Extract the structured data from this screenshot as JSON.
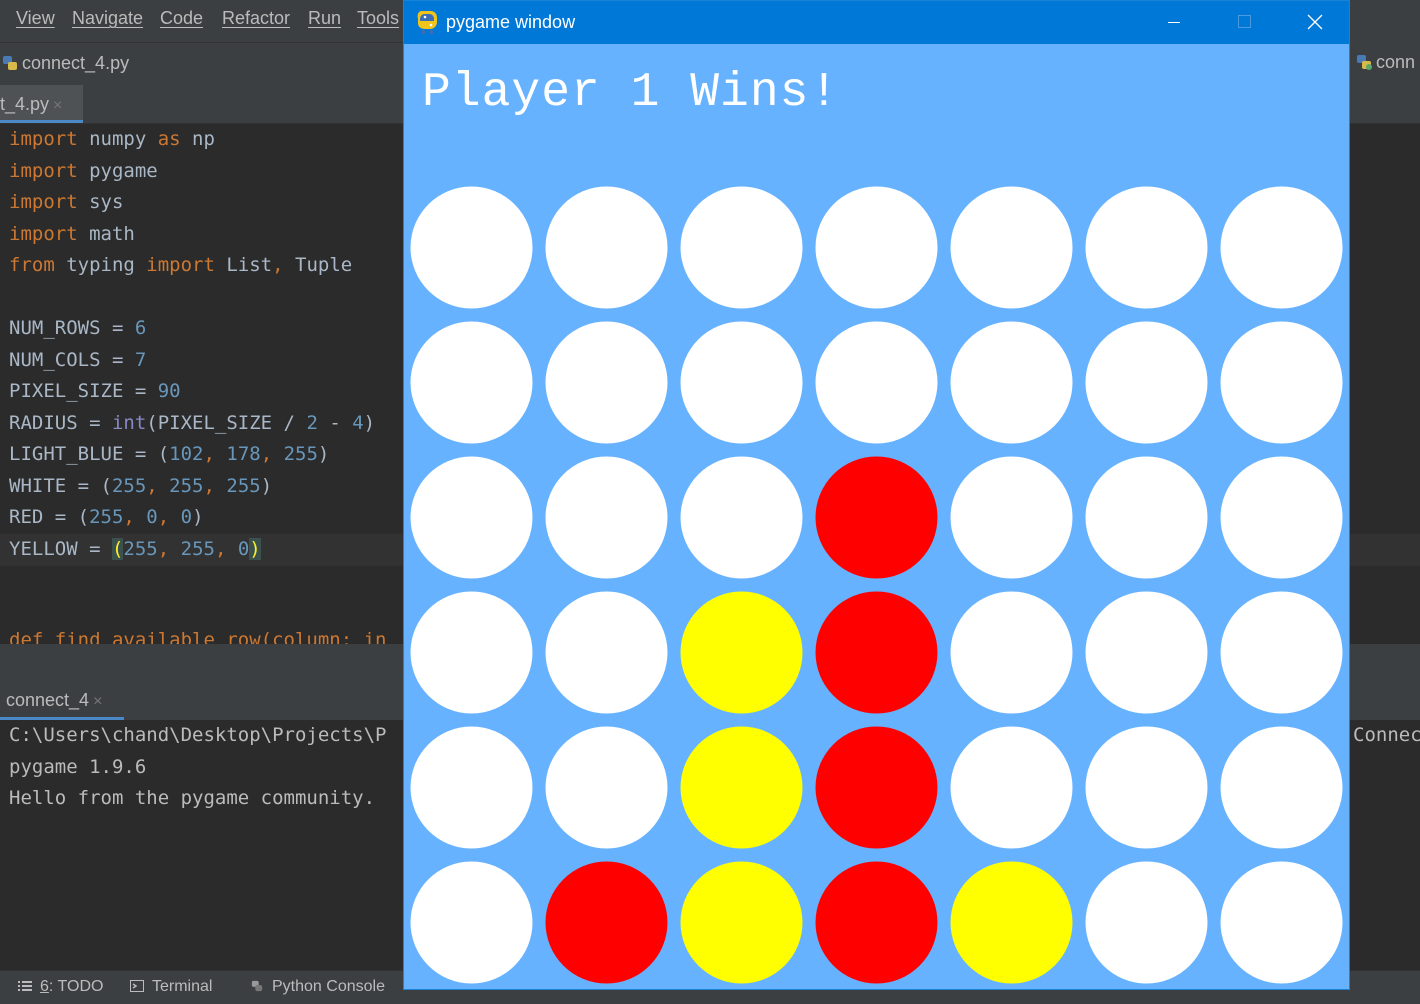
{
  "menubar": {
    "items": [
      "View",
      "Navigate",
      "Code",
      "Refactor",
      "Run",
      "Tools"
    ]
  },
  "navbar": {
    "file_label": "connect_4.py",
    "right_file_label": "conn"
  },
  "editor": {
    "tab_label": "t_4.py",
    "tab_close": "×"
  },
  "code": {
    "line1": {
      "kw": "import",
      "rest1": " numpy ",
      "kw2": "as",
      "rest2": " np"
    },
    "line2": {
      "kw": "import",
      "rest": " pygame"
    },
    "line3": {
      "kw": "import",
      "rest": " sys"
    },
    "line4": {
      "kw": "import",
      "rest": " math"
    },
    "line5": {
      "kw1": "from",
      "mid": " typing ",
      "kw2": "import",
      "rest": " List",
      "comma": ",",
      "rest2": " Tuple"
    },
    "num_rows": {
      "name": "NUM_ROWS = ",
      "value": "6"
    },
    "num_cols": {
      "name": "NUM_COLS = ",
      "value": "7"
    },
    "pixel_size": {
      "name": "PIXEL_SIZE = ",
      "value": "90"
    },
    "radius": {
      "name": "RADIUS = ",
      "fn": "int",
      "arg": "(PIXEL_SIZE / ",
      "n1": "2",
      "op": " - ",
      "n2": "4",
      "close": ")"
    },
    "light_blue": {
      "name": "LIGHT_BLUE = (",
      "v1": "102",
      "c1": ", ",
      "v2": "178",
      "c2": ", ",
      "v3": "255",
      "close": ")"
    },
    "white": {
      "name": "WHITE = (",
      "v1": "255",
      "c1": ", ",
      "v2": "255",
      "c2": ", ",
      "v3": "255",
      "close": ")"
    },
    "red": {
      "name": "RED = (",
      "v1": "255",
      "c1": ", ",
      "v2": "0",
      "c2": ", ",
      "v3": "0",
      "close": ")"
    },
    "yellow": {
      "name": "YELLOW = ",
      "open": "(",
      "v1": "255",
      "c1": ", ",
      "v2": "255",
      "c2": ", ",
      "v3": "0",
      "close": ")"
    },
    "def_line": "def find_available_row(column: in"
  },
  "run_panel": {
    "tab_label": "connect_4",
    "tab_close": "×"
  },
  "console": {
    "line1": "C:\\Users\\chand\\Desktop\\Projects\\P",
    "line2": "pygame 1.9.6",
    "line3": "Hello from the pygame community.",
    "right_fragment": "Connec"
  },
  "statusbar": {
    "todo_prefix": "6",
    "todo_label": ": TODO",
    "terminal_label": "Terminal",
    "python_console_label": "Python Console"
  },
  "pygame_window": {
    "title": "pygame window",
    "message": "Player 1 Wins!",
    "colors": {
      "background": "#66b2ff",
      "empty": "#ffffff",
      "red": "#ff0000",
      "yellow": "#ffff00"
    },
    "board": [
      [
        "empty",
        "empty",
        "empty",
        "empty",
        "empty",
        "empty",
        "empty"
      ],
      [
        "empty",
        "empty",
        "empty",
        "empty",
        "empty",
        "empty",
        "empty"
      ],
      [
        "empty",
        "empty",
        "empty",
        "red",
        "empty",
        "empty",
        "empty"
      ],
      [
        "empty",
        "empty",
        "yellow",
        "red",
        "empty",
        "empty",
        "empty"
      ],
      [
        "empty",
        "empty",
        "yellow",
        "red",
        "empty",
        "empty",
        "empty"
      ],
      [
        "empty",
        "red",
        "yellow",
        "red",
        "yellow",
        "empty",
        "empty"
      ]
    ]
  }
}
